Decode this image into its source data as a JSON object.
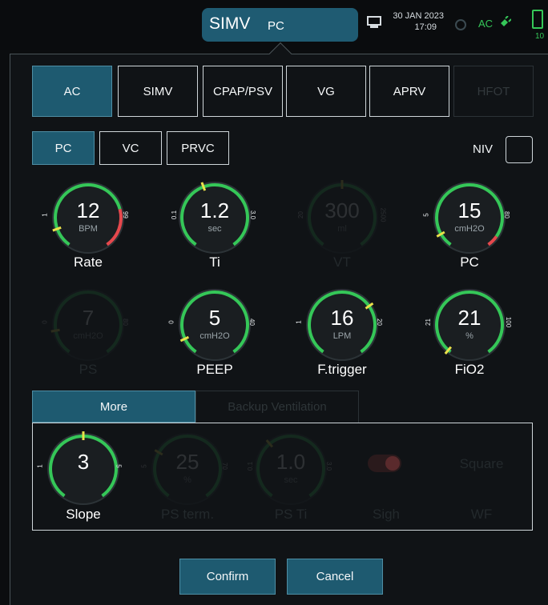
{
  "header": {
    "mode_main": "SIMV",
    "mode_sub": "PC",
    "date": "30 JAN 2023",
    "time": "17:09",
    "power_source": "AC",
    "battery_text": "10"
  },
  "modes": [
    {
      "label": "AC",
      "state": "active"
    },
    {
      "label": "SIMV",
      "state": "normal"
    },
    {
      "label": "CPAP/PSV",
      "state": "normal"
    },
    {
      "label": "VG",
      "state": "normal"
    },
    {
      "label": "APRV",
      "state": "normal"
    },
    {
      "label": "HFOT",
      "state": "disabled"
    }
  ],
  "submodes": [
    {
      "label": "PC",
      "state": "active"
    },
    {
      "label": "VC",
      "state": "normal"
    },
    {
      "label": "PRVC",
      "state": "normal"
    }
  ],
  "niv": {
    "label": "NIV",
    "checked": false
  },
  "dials": [
    {
      "label": "Rate",
      "value": "12",
      "unit": "BPM",
      "min": "1",
      "max": "99",
      "enabled": true
    },
    {
      "label": "Ti",
      "value": "1.2",
      "unit": "sec",
      "min": "0.1",
      "max": "3.0",
      "enabled": true
    },
    {
      "label": "VT",
      "value": "300",
      "unit": "ml",
      "min": "20",
      "max": "2500",
      "enabled": false
    },
    {
      "label": "PC",
      "value": "15",
      "unit": "cmH2O",
      "min": "5",
      "max": "80",
      "enabled": true
    },
    {
      "label": "PS",
      "value": "7",
      "unit": "cmH2O",
      "min": "0",
      "max": "80",
      "enabled": false
    },
    {
      "label": "PEEP",
      "value": "5",
      "unit": "cmH2O",
      "min": "0",
      "max": "40",
      "enabled": true
    },
    {
      "label": "F.trigger",
      "value": "16",
      "unit": "LPM",
      "min": "1",
      "max": "20",
      "enabled": true
    },
    {
      "label": "FiO2",
      "value": "21",
      "unit": "%",
      "min": "21",
      "max": "100",
      "enabled": true
    }
  ],
  "tabs": {
    "more": "More",
    "backup": "Backup Ventilation"
  },
  "more_dials": [
    {
      "label": "Slope",
      "value": "3",
      "unit": "",
      "min": "1",
      "max": "5",
      "enabled": true
    },
    {
      "label": "PS term.",
      "value": "25",
      "unit": "%",
      "min": "5",
      "max": "70",
      "enabled": false
    },
    {
      "label": "PS Ti",
      "value": "1.0",
      "unit": "sec",
      "min": "0.1",
      "max": "3.0",
      "enabled": false
    }
  ],
  "sigh": {
    "label": "Sigh",
    "enabled": false
  },
  "waveform": {
    "label": "WF",
    "value": "Square",
    "enabled": false
  },
  "buttons": {
    "confirm": "Confirm",
    "cancel": "Cancel"
  },
  "colors": {
    "accent": "#1e5a70",
    "green": "#35c758",
    "alarm_red": "#e5484d",
    "marker_yellow": "#e9e14a"
  }
}
